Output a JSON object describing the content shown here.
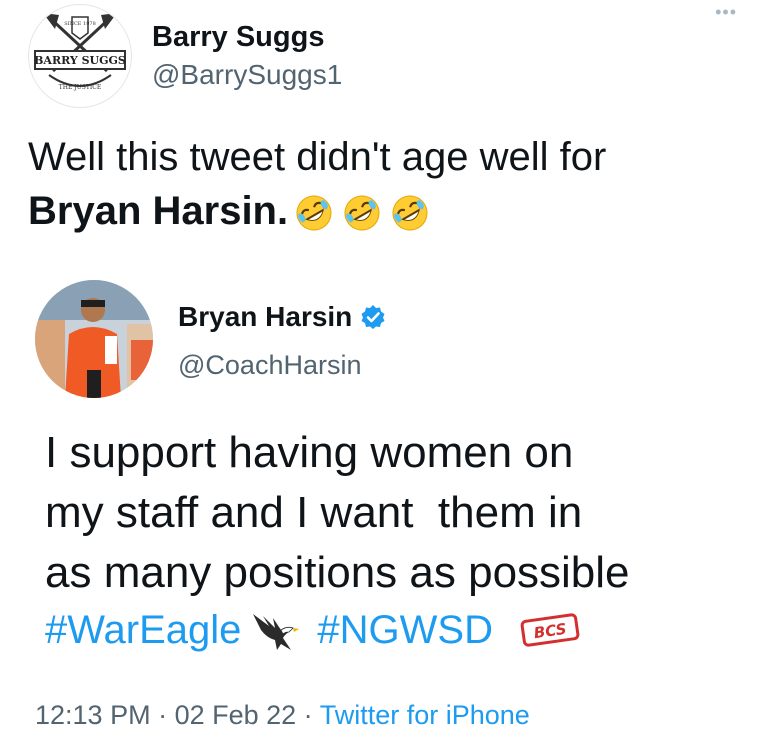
{
  "outer": {
    "author": {
      "display_name": "Barry Suggs",
      "handle": "@BarrySuggs1",
      "avatar_text": "BARRY SUGGS",
      "avatar_top_text": "SINCE 1978",
      "avatar_bottom_text": "THE JUSTICE"
    },
    "more_label": "•••",
    "text_line1": "Well this tweet didn't age well for",
    "text_mention": "Bryan Harsin.",
    "emoji": "rolling-on-the-floor-laughing-icon",
    "emoji_count": 3
  },
  "quoted": {
    "author": {
      "display_name": "Bryan Harsin",
      "handle": "@CoachHarsin",
      "verified": true
    },
    "text_lines": [
      "I support having women on",
      "my staff and I want  them in",
      "as many positions as possible"
    ],
    "hashtags": [
      "#WarEagle",
      "#NGWSD"
    ],
    "eagle_icon": "eagle-icon",
    "bcs_badge_text": "BCS",
    "meta": {
      "time": "12:13 PM",
      "sep1": " · ",
      "date": "02 Feb 22",
      "sep2": " · ",
      "source": "Twitter for iPhone"
    }
  },
  "colors": {
    "link": "#1d9bf0",
    "secondary_text": "#536471",
    "primary_text": "#0f1419",
    "bcs_red": "#d32f2f"
  }
}
